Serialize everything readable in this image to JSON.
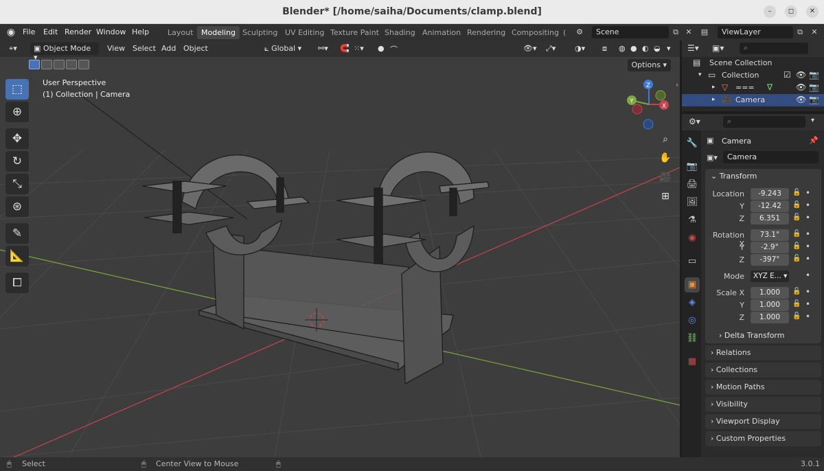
{
  "window": {
    "title": "Blender* [/home/saiha/Documents/clamp.blend]"
  },
  "menu": {
    "items": [
      "File",
      "Edit",
      "Render",
      "Window",
      "Help"
    ],
    "workspaces": [
      "Layout",
      "Modeling",
      "Sculpting",
      "UV Editing",
      "Texture Paint",
      "Shading",
      "Animation",
      "Rendering",
      "Compositing",
      "("
    ],
    "active_workspace": "Modeling",
    "scene": "Scene",
    "view_layer": "ViewLayer"
  },
  "viewport": {
    "mode": "Object Mode",
    "menus": [
      "View",
      "Select",
      "Add",
      "Object"
    ],
    "orientation": "Global",
    "perspective_label": "User Perspective",
    "context_label": "(1) Collection | Camera",
    "options_label": "Options",
    "gizmo_axes": [
      "X",
      "Y",
      "Z"
    ]
  },
  "outliner": {
    "root": "Scene Collection",
    "rows": [
      {
        "label": "Collection",
        "selected": false
      },
      {
        "label": "===",
        "selected": false
      },
      {
        "label": "Camera",
        "selected": true
      }
    ]
  },
  "properties": {
    "object_name": "Camera",
    "data_name": "Camera",
    "transform_title": "Transform",
    "location": {
      "label": "Location",
      "x": "-9.243",
      "y": "-12.42",
      "z": "6.351"
    },
    "rotation": {
      "label": "Rotation X",
      "x": "73.1°",
      "y": "-2.9°",
      "z": "-397°"
    },
    "mode": {
      "label": "Mode",
      "value": "XYZ E..."
    },
    "scale": {
      "label": "Scale X",
      "x": "1.000",
      "y": "1.000",
      "z": "1.000"
    },
    "axis_labels": {
      "y": "Y",
      "z": "Z"
    },
    "delta_transform": "Delta Transform",
    "panels": [
      "Relations",
      "Collections",
      "Motion Paths",
      "Visibility",
      "Viewport Display",
      "Custom Properties"
    ]
  },
  "statusbar": {
    "left": "Select",
    "middle": "Center View to Mouse",
    "version": "3.0.1"
  },
  "colors": {
    "accent": "#4772b3",
    "x_axis": "#c8434f",
    "y_axis": "#7ea83b",
    "z_axis": "#3f7ad6"
  }
}
